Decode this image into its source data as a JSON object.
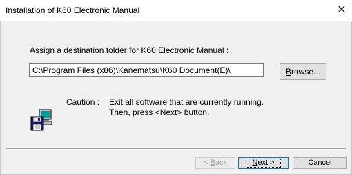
{
  "window": {
    "title": "Installation of K60 Electronic Manual",
    "close_glyph": "✕"
  },
  "destination": {
    "label": "Assign a destination folder for K60 Electronic Manual :",
    "path_value": "C:\\Program Files (x86)\\Kanematsu\\K60 Document(E)\\",
    "browse_label_underline": "B",
    "browse_label_rest": "rowse..."
  },
  "caution": {
    "label": "Caution :",
    "line1": "Exit all software that are currently running.",
    "line2": "Then, press <Next> button.",
    "icon": "floppy-disk-computer-icon"
  },
  "buttons": {
    "back_prefix": "< ",
    "back_underline": "B",
    "back_rest": "ack",
    "next_underline": "N",
    "next_rest": "ext >",
    "cancel_label": "Cancel"
  },
  "colors": {
    "window_bg": "#f0f0f0",
    "accent_focus": "#0078d7",
    "disabled_text": "#a0a0a0"
  }
}
